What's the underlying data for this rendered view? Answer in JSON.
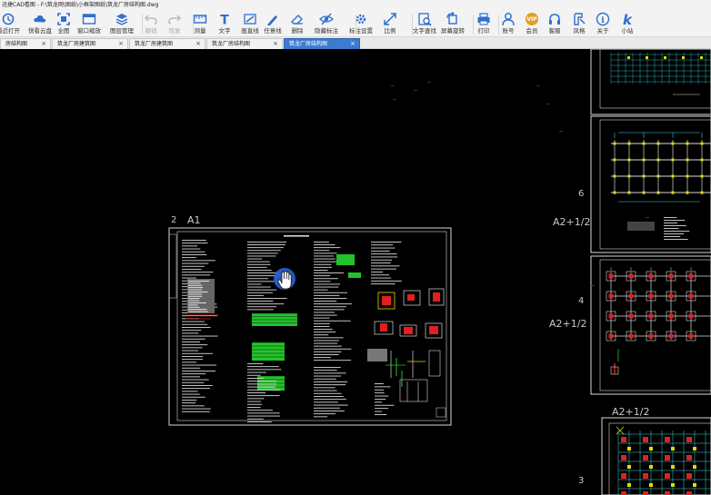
{
  "window": {
    "title": "迅捷CAD看图 - F:\\筑龙网\\图纸\\小框架图纸\\筑龙厂房结构图.dwg"
  },
  "toolbar": {
    "items": [
      {
        "label": "最近打开",
        "icon": "recent-icon"
      },
      {
        "label": "快看云盘",
        "icon": "cloud-icon"
      },
      {
        "label": "全图",
        "icon": "full-view-icon"
      },
      {
        "label": "窗口缩放",
        "icon": "window-zoom-icon"
      },
      {
        "label": "图层管理",
        "icon": "layers-icon"
      },
      {
        "label": "撤销",
        "icon": "undo-icon"
      },
      {
        "label": "恢复",
        "icon": "redo-icon"
      },
      {
        "label": "测量",
        "icon": "measure-icon"
      },
      {
        "label": "文字",
        "icon": "text-icon"
      },
      {
        "label": "画直线",
        "icon": "line-icon"
      },
      {
        "label": "任意线",
        "icon": "freehand-icon"
      },
      {
        "label": "删除",
        "icon": "eraser-icon"
      },
      {
        "label": "隐藏标注",
        "icon": "hide-icon"
      },
      {
        "label": "标注设置",
        "icon": "annotation-settings-icon"
      },
      {
        "label": "比例",
        "icon": "scale-icon"
      },
      {
        "label": "文字查找",
        "icon": "text-search-icon"
      },
      {
        "label": "屏幕旋转",
        "icon": "rotate-icon"
      },
      {
        "label": "打印",
        "icon": "print-icon"
      },
      {
        "label": "账号",
        "icon": "account-icon"
      },
      {
        "label": "会员",
        "icon": "vip-icon"
      },
      {
        "label": "客服",
        "icon": "headset-icon"
      },
      {
        "label": "风格",
        "icon": "style-icon"
      },
      {
        "label": "关于",
        "icon": "info-icon"
      },
      {
        "label": "小站",
        "icon": "site-icon"
      }
    ],
    "vip_badge": "VIP",
    "about_glyph": "i",
    "site_glyph": "k",
    "text_glyph": "T"
  },
  "tabs": [
    {
      "label": "房结构图",
      "active": false
    },
    {
      "label": "筑龙厂房建筑图",
      "active": false
    },
    {
      "label": "筑龙厂房建筑图",
      "active": false
    },
    {
      "label": "筑龙厂房结构图",
      "active": false
    },
    {
      "label": "筑龙厂房结构图",
      "active": true
    }
  ],
  "tab_close": "×",
  "drawing": {
    "sheet_labels": {
      "main_number": "2",
      "main_size": "A1",
      "right_number_1": "6",
      "right_size_1": "A2+1/2",
      "right_number_2": "4",
      "right_size_2": "A2+1/2",
      "right_size_3": "A2+1/2",
      "right_number_3": "3"
    }
  },
  "colors": {
    "toolbar_bg": "#f3f3f3",
    "canvas_bg": "#000000",
    "active_tab": "#3d7bd0",
    "icon_blue": "#2f6fcf",
    "vip_gold": "#e0a020",
    "cad_white": "#d8d8d8",
    "cad_green": "#22c32a",
    "cad_red": "#e02020",
    "cad_yellow": "#e6d800",
    "cad_cyan": "#35d8e0",
    "cursor_blue": "#2a62d6"
  }
}
